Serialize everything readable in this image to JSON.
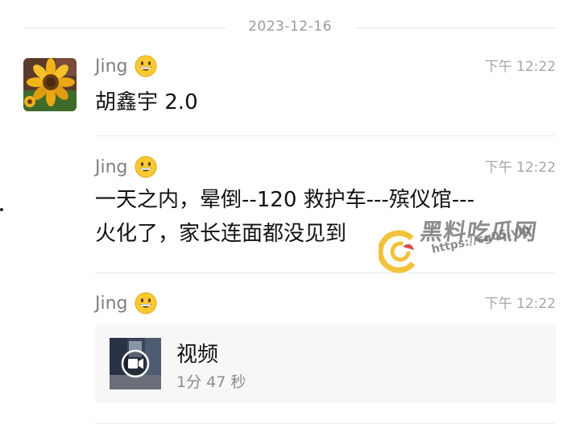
{
  "date_separator": "2023-12-16",
  "messages": [
    {
      "sender": "Jing",
      "time": "下午 12:22",
      "text": "胡鑫宇 2.0"
    },
    {
      "sender": "Jing",
      "time": "下午 12:22",
      "line1": "一天之内，晕倒--120 救护车---殡仪馆---",
      "line2": "火化了，家长连面都没见到"
    },
    {
      "sender": "Jing",
      "time": "下午 12:22",
      "video": {
        "title": "视频",
        "duration": "1分 47 秒"
      }
    }
  ],
  "watermark": {
    "title": "黑料吃瓜网",
    "url": "https://cg05.vip"
  },
  "colors": {
    "meta": "#a6a6a6",
    "sender": "#7f7f7f",
    "card": "#f7f7f7"
  }
}
